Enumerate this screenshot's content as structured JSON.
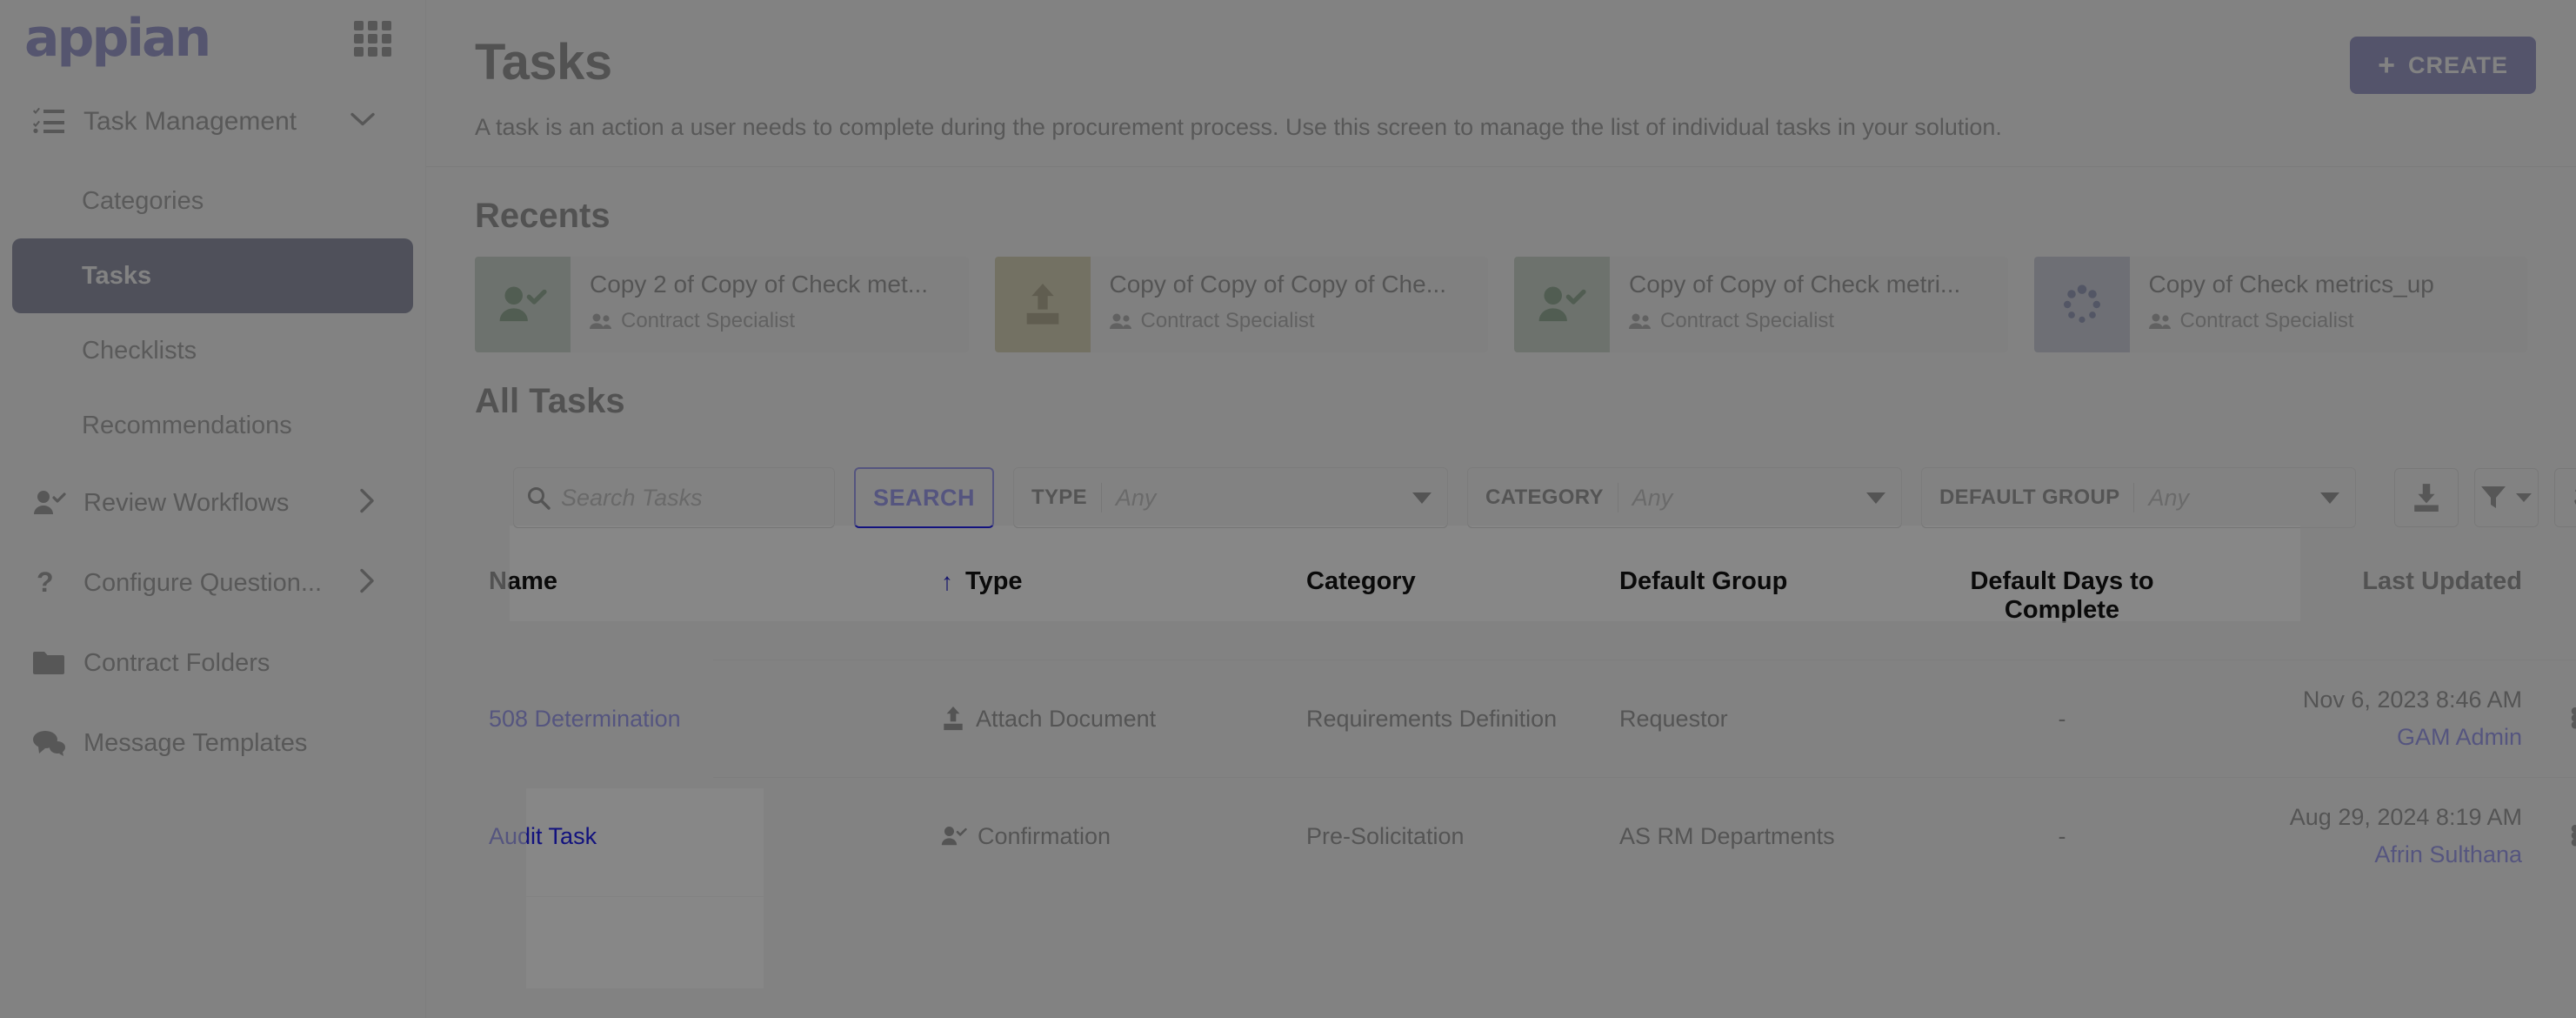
{
  "brand": {
    "logo_text": "appian",
    "logo_color": "#2323a0"
  },
  "sidebar": {
    "apps_icon": "grid-apps-icon",
    "group": {
      "label": "Task Management",
      "icon": "task-list-icon",
      "chevron": "chevron-down-icon"
    },
    "sub_items": [
      {
        "label": "Categories",
        "active": false
      },
      {
        "label": "Tasks",
        "active": true
      },
      {
        "label": "Checklists",
        "active": false
      },
      {
        "label": "Recommendations",
        "active": false
      }
    ],
    "nav_items": [
      {
        "label": "Review Workflows",
        "icon": "user-check-icon",
        "chevron": "chevron-right-icon"
      },
      {
        "label": "Configure Question...",
        "icon": "question-mark-icon",
        "chevron": "chevron-right-icon"
      },
      {
        "label": "Contract Folders",
        "icon": "folder-icon",
        "chevron": ""
      },
      {
        "label": "Message Templates",
        "icon": "chat-bubbles-icon",
        "chevron": ""
      }
    ]
  },
  "header": {
    "title": "Tasks",
    "description": "A task is an action a user needs to complete during the procurement process. Use this screen to manage the list of individual tasks in your solution.",
    "create_label": "CREATE",
    "create_plus": "+",
    "create_color": "#1d1d8f"
  },
  "recents": {
    "title": "Recents",
    "cards": [
      {
        "name": "Copy 2 of Copy of Check met...",
        "meta": "Contract Specialist",
        "icon": "user-check-icon",
        "thumb_color": "#97b199",
        "icon_color": "#0d4a13"
      },
      {
        "name": "Copy of Copy of Copy of Che...",
        "meta": "Contract Specialist",
        "icon": "upload-document-icon",
        "thumb_color": "#b3a866",
        "icon_color": "#5a4a06"
      },
      {
        "name": "Copy of Copy of Check metri...",
        "meta": "Contract Specialist",
        "icon": "user-check-icon",
        "thumb_color": "#95b097",
        "icon_color": "#0d4a13"
      },
      {
        "name": "Copy of Check metrics_up",
        "meta": "Contract Specialist",
        "icon": "loading-spinner-icon",
        "thumb_color": "#9aa3bd",
        "icon_color": "#15246e"
      }
    ]
  },
  "all_tasks": {
    "title": "All Tasks",
    "search": {
      "placeholder": "Search Tasks",
      "value": "",
      "icon": "search-icon",
      "button_label": "SEARCH"
    },
    "filters": [
      {
        "key": "TYPE",
        "value": "Any"
      },
      {
        "key": "CATEGORY",
        "value": "Any"
      },
      {
        "key": "DEFAULT GROUP",
        "value": "Any"
      }
    ],
    "toolbar_icons": [
      {
        "name": "export-download-icon"
      },
      {
        "name": "filter-icon"
      },
      {
        "name": "refresh-icon"
      }
    ],
    "columns": [
      {
        "label": "Name",
        "sorted": false
      },
      {
        "label": "Type",
        "sorted": true,
        "sort_dir": "asc",
        "sort_arrow": "↑"
      },
      {
        "label": "Category",
        "sorted": false
      },
      {
        "label": "Default Group",
        "sorted": false
      },
      {
        "label": "Default Days to Complete",
        "sorted": false
      },
      {
        "label": "Last Updated",
        "sorted": false
      }
    ],
    "rows": [
      {
        "name": "508 Determination",
        "type": "Attach Document",
        "type_icon": "upload-document-icon",
        "category": "Requirements Definition",
        "default_group": "Requestor",
        "default_days": "-",
        "updated_date": "Nov 6, 2023 8:46 AM",
        "updated_user": "GAM Admin",
        "menu_icon": "kebab-menu-icon"
      },
      {
        "name": "Audit Task",
        "type": "Confirmation",
        "type_icon": "user-check-icon",
        "category": "Pre-Solicitation",
        "default_group": "AS RM Departments",
        "default_days": "-",
        "updated_date": "Aug 29, 2024 8:19 AM",
        "updated_user": "Afrin Sulthana",
        "menu_icon": "kebab-menu-icon"
      }
    ]
  }
}
